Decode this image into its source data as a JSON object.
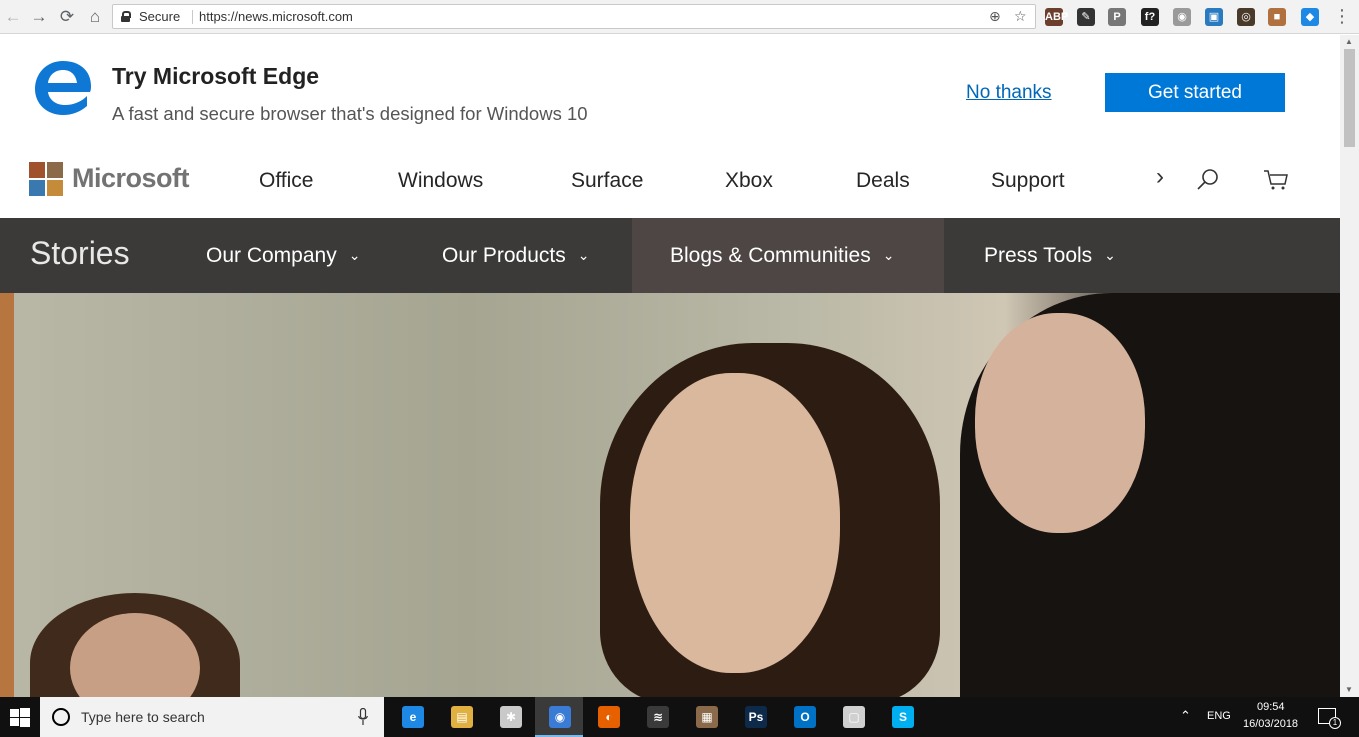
{
  "browser": {
    "secure_label": "Secure",
    "url": "https://news.microsoft.com",
    "back_icon": "back-arrow-icon",
    "forward_icon": "forward-arrow-icon",
    "reload_icon": "reload-icon",
    "home_icon": "home-icon",
    "extensions": [
      {
        "name": "adblock-extension-icon",
        "glyph": "ABP",
        "color": "#6b3e2e"
      },
      {
        "name": "color-picker-extension-icon",
        "glyph": "✎",
        "color": "#333333"
      },
      {
        "name": "pinterest-extension-icon",
        "glyph": "P",
        "color": "#777777"
      },
      {
        "name": "font-finder-extension-icon",
        "glyph": "f?",
        "color": "#222222"
      },
      {
        "name": "camera-extension-icon",
        "glyph": "◉",
        "color": "#9a9a9a"
      },
      {
        "name": "clip-extension-icon",
        "glyph": "▣",
        "color": "#2a7ac0"
      },
      {
        "name": "eye-extension-icon",
        "glyph": "◎",
        "color": "#4a3a2a"
      },
      {
        "name": "box-extension-icon",
        "glyph": "■",
        "color": "#b07040"
      },
      {
        "name": "tag-extension-icon",
        "glyph": "◆",
        "color": "#1e88e5"
      }
    ]
  },
  "edge_banner": {
    "title": "Try Microsoft Edge",
    "subtitle": "A fast and secure browser that's designed for Windows 10",
    "no_thanks": "No thanks",
    "get_started": "Get started",
    "accent": "#0078d7"
  },
  "ms_header": {
    "wordmark": "Microsoft",
    "nav": [
      "Office",
      "Windows",
      "Surface",
      "Xbox",
      "Deals",
      "Support"
    ]
  },
  "stories_nav": {
    "title": "Stories",
    "items": [
      {
        "label": "Our Company",
        "active": false
      },
      {
        "label": "Our Products",
        "active": false
      },
      {
        "label": "Blogs & Communities",
        "active": true
      },
      {
        "label": "Press Tools",
        "active": false
      }
    ]
  },
  "taskbar": {
    "search_placeholder": "Type here to search",
    "apps": [
      {
        "name": "edge-app-icon",
        "glyph": "e",
        "color": "#1e88e5",
        "active": false
      },
      {
        "name": "file-explorer-app-icon",
        "glyph": "▤",
        "color": "#e0b040",
        "active": false
      },
      {
        "name": "paint-app-icon",
        "glyph": "✱",
        "color": "#c9c9c9",
        "active": false
      },
      {
        "name": "chrome-app-icon",
        "glyph": "◉",
        "color": "#3a7bd5",
        "active": true
      },
      {
        "name": "firefox-app-icon",
        "glyph": "◐",
        "color": "#e66000",
        "active": false
      },
      {
        "name": "spotify-app-icon",
        "glyph": "≋",
        "color": "#3a3a3a",
        "active": false
      },
      {
        "name": "app-generic-icon",
        "glyph": "▦",
        "color": "#8a6a4a",
        "active": false
      },
      {
        "name": "photoshop-app-icon",
        "glyph": "Ps",
        "color": "#0d2a4a",
        "active": false
      },
      {
        "name": "outlook-app-icon",
        "glyph": "O",
        "color": "#0072c6",
        "active": false
      },
      {
        "name": "window-app-icon",
        "glyph": "▢",
        "color": "#d0d0d0",
        "active": false
      },
      {
        "name": "skype-app-icon",
        "glyph": "S",
        "color": "#00aff0",
        "active": false
      }
    ],
    "lang": "ENG",
    "time": "09:54",
    "date": "16/03/2018",
    "notifications": "1"
  }
}
